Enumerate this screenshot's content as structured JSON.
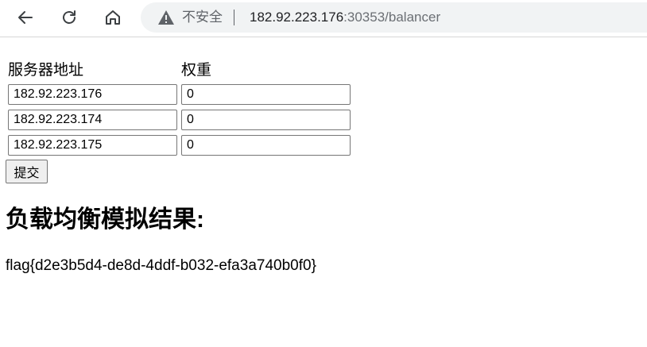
{
  "browser": {
    "security_label": "不安全",
    "url_host": "182.92.223.176",
    "url_rest": ":30353/balancer"
  },
  "form": {
    "server_header": "服务器地址",
    "weight_header": "权重",
    "rows": [
      {
        "server": "182.92.223.176",
        "weight": "0"
      },
      {
        "server": "182.92.223.174",
        "weight": "0"
      },
      {
        "server": "182.92.223.175",
        "weight": "0"
      }
    ],
    "submit_label": "提交"
  },
  "result": {
    "title": "负载均衡模拟结果:",
    "text": "flag{d2e3b5d4-de8d-4ddf-b032-efa3a740b0f0}"
  },
  "icons": {
    "back": "back-arrow-icon",
    "reload": "reload-icon",
    "home": "home-icon",
    "warning": "warning-triangle-icon"
  }
}
